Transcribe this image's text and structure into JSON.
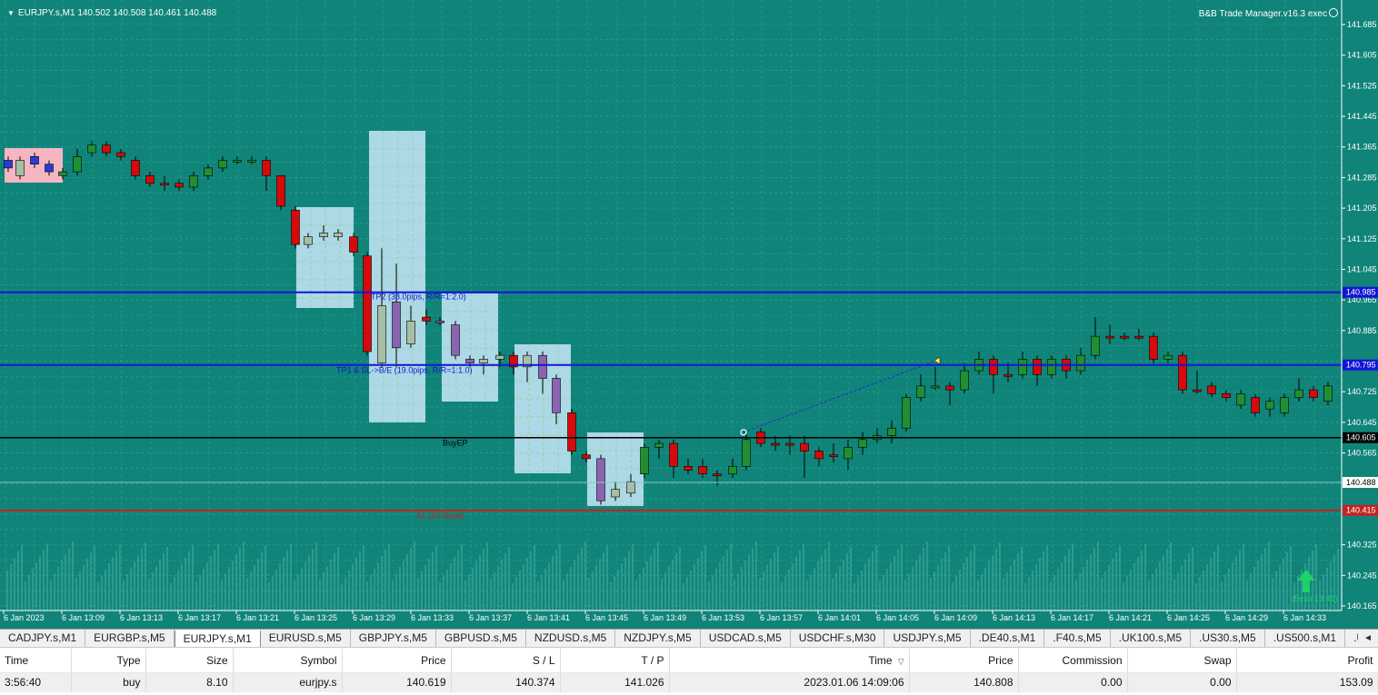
{
  "chart": {
    "title": "EURJPY.s,M1  140.502 140.508 140.461 140.488",
    "ea_label": "B&B Trade Manager.v16.3 exec",
    "colors": {
      "background": "#108479",
      "grid": "#2ea597",
      "bull": "#1f8f32",
      "bear": "#d60a0a",
      "purple": "#8b64b0",
      "pale": "#a6bfa6",
      "zone": "#add8e6",
      "pink_zone": "#f5b6c2",
      "tp_line": "#1414d6",
      "entry_line": "#000000",
      "sl_line": "#c32222"
    },
    "price_axis": [
      "141.685",
      "141.605",
      "141.525",
      "141.445",
      "141.365",
      "141.285",
      "141.205",
      "141.125",
      "141.045",
      "140.965",
      "140.885",
      "140.725",
      "140.645",
      "140.565",
      "140.325",
      "140.245",
      "140.165"
    ],
    "price_markers": {
      "tp2": "140.985",
      "tp1": "140.795",
      "entry": "140.605",
      "current": "140.488",
      "sl": "140.415"
    },
    "time_axis": [
      "6 Jan 2023",
      "6 Jan 13:09",
      "6 Jan 13:13",
      "6 Jan 13:17",
      "6 Jan 13:21",
      "6 Jan 13:25",
      "6 Jan 13:29",
      "6 Jan 13:33",
      "6 Jan 13:37",
      "6 Jan 13:41",
      "6 Jan 13:45",
      "6 Jan 13:49",
      "6 Jan 13:53",
      "6 Jan 13:57",
      "6 Jan 14:01",
      "6 Jan 14:05",
      "6 Jan 14:09",
      "6 Jan 14:13",
      "6 Jan 14:17",
      "6 Jan 14:21",
      "6 Jan 14:25",
      "6 Jan 14:29",
      "6 Jan 14:33"
    ],
    "annotations": {
      "tp2": "TP2 (38.0pips, R/R=1:2.0)",
      "tp1": "TP1 & SL->B/E (19.0pips, R/R=1:1.0)",
      "entry": "BuyEP",
      "sl": "SL (19.0pips)",
      "timer": "(5min 13:45)"
    },
    "icons": {
      "menu": "triangle-down-icon",
      "ea": "smiley-icon",
      "arrow": "up-arrow-icon"
    }
  },
  "tabs": [
    "CADJPY.s,M1",
    "EURGBP.s,M5",
    "EURJPY.s,M1",
    "EURUSD.s,M5",
    "GBPJPY.s,M5",
    "GBPUSD.s,M5",
    "NZDUSD.s,M5",
    "NZDJPY.s,M5",
    "USDCAD.s,M5",
    "USDCHF.s,M30",
    "USDJPY.s,M5",
    ".DE40.s,M1",
    ".F40.s,M5",
    ".UK100.s,M5",
    ".US30.s,M5",
    ".US500.s,M1",
    ".USTEC"
  ],
  "active_tab": "EURJPY.s,M1",
  "table": {
    "columns": [
      "Time",
      "Type",
      "Size",
      "Symbol",
      "Price",
      "S / L",
      "T / P",
      "Time",
      "Price",
      "Commission",
      "Swap",
      "Profit"
    ],
    "sort_indicator": "▽",
    "row": [
      "3:56:40",
      "buy",
      "8.10",
      "eurjpy.s",
      "140.619",
      "140.374",
      "141.026",
      "2023.01.06 14:09:06",
      "140.808",
      "0.00",
      "0.00",
      "153.09"
    ]
  }
}
